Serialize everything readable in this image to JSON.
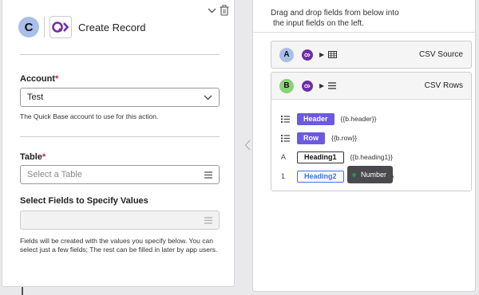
{
  "step": {
    "letter": "C",
    "title": "Create Record"
  },
  "account": {
    "label": "Account",
    "required_mark": "*",
    "value": "Test",
    "help": "The Quick Base account to use for this action."
  },
  "table": {
    "label": "Table",
    "required_mark": "*",
    "placeholder": "Select a Table"
  },
  "select_fields": {
    "label": "Select Fields to Specify Values",
    "help": "Fields will be created with the values you specify below. You can select just a few fields; The rest can be filled in later by app users."
  },
  "right": {
    "instructions_line1": "Drag and drop fields from below into",
    "instructions_line2": "the input fields on the left."
  },
  "sources": [
    {
      "letter": "A",
      "label": "CSV Source",
      "color": "#a9bfe9",
      "icon": "table-grid-icon"
    },
    {
      "letter": "B",
      "label": "CSV Rows",
      "color": "#8dd07a",
      "icon": "list-icon"
    }
  ],
  "fields": [
    {
      "type_icon": "list-icon",
      "chip": "Header",
      "expr": "{{b.header}}",
      "style": "solid"
    },
    {
      "type_icon": "list-icon",
      "chip": "Row",
      "expr": "{{b.row}}",
      "style": "solid"
    },
    {
      "type_icon": "A",
      "chip": "Heading1",
      "expr": "{{b.heading1}}",
      "style": "outline"
    },
    {
      "type_icon": "1",
      "chip": "Heading2",
      "expr": "}",
      "style": "blue-outline"
    }
  ],
  "tooltip": {
    "text": "Number"
  },
  "colors": {
    "accent": "#6b5ae0",
    "required": "#d0222a",
    "brand": "#6f2da8"
  }
}
